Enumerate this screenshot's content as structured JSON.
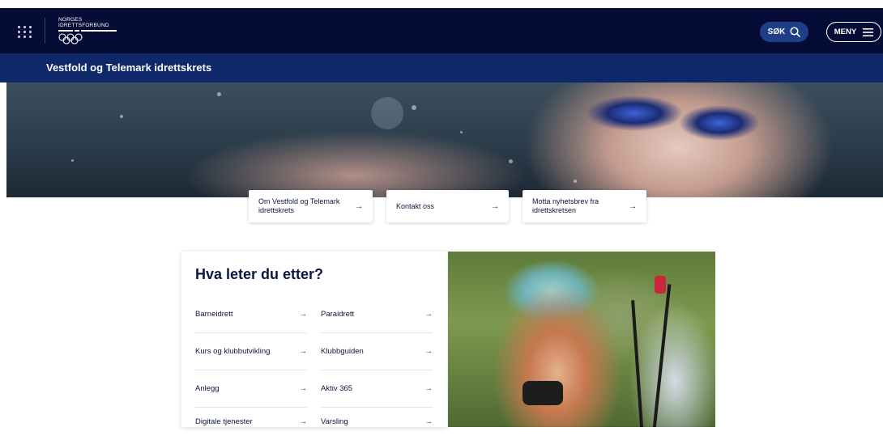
{
  "header": {
    "logo_line1": "NORGES",
    "logo_line2": "IDRETTSFORBUND",
    "search_label": "SØK",
    "menu_label": "MENY"
  },
  "subheader": {
    "title": "Vestfold og Telemark idrettskrets"
  },
  "quick_links": [
    {
      "label": "Om Vestfold og Telemark idrettskrets",
      "arrow": "→"
    },
    {
      "label": "Kontakt oss",
      "arrow": "→"
    },
    {
      "label": "Motta nyhetsbrev fra idrettskretsen",
      "arrow": "→"
    }
  ],
  "panel": {
    "heading": "Hva leter du etter?",
    "links": [
      {
        "label": "Barneidrett",
        "arrow": "→"
      },
      {
        "label": "Paraidrett",
        "arrow": "→"
      },
      {
        "label": "Kurs og klubbutvikling",
        "arrow": "→"
      },
      {
        "label": "Klubbguiden",
        "arrow": "→"
      },
      {
        "label": "Anlegg",
        "arrow": "→"
      },
      {
        "label": "Aktiv 365",
        "arrow": "→"
      },
      {
        "label": "Digitale tjenester",
        "arrow": "→"
      },
      {
        "label": "Varsling",
        "arrow": "→"
      }
    ]
  },
  "icons": {
    "apps": "grid-icon",
    "search": "search-icon",
    "menu": "hamburger-icon",
    "logo": "olympic-rings-icon"
  },
  "colors": {
    "topbar": "#050d36",
    "subbar": "#0f2869",
    "search_button": "#1f3e86",
    "text_dark": "#0b1740"
  }
}
